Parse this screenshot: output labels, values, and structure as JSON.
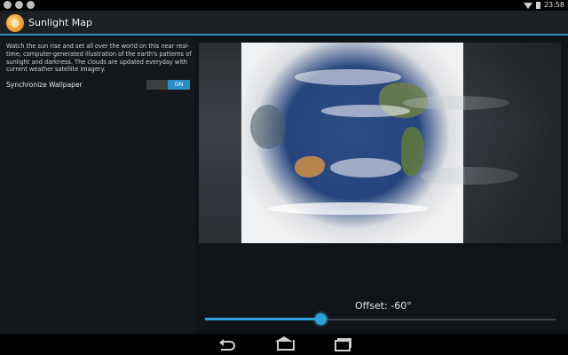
{
  "status_bar": {
    "time": "23:58",
    "left_icons": [
      "notification-icon",
      "sync-icon",
      "android-icon"
    ],
    "right_icons": [
      "wifi-icon",
      "battery-icon"
    ]
  },
  "action_bar": {
    "title": "Sunlight Map",
    "icon": "sun-globe-icon",
    "accent_color": "#2e8ec0"
  },
  "left_panel": {
    "description": "Watch the sun rise and set all over the world on this near real-time, computer-generated illustration of the earth's patterns of sunlight and darkness. The clouds are updated everyday with current weather satellite imagery.",
    "sync": {
      "label": "Synchronize Wallpaper",
      "toggle_state": "ON"
    }
  },
  "offset": {
    "label": "Offset: -60°",
    "value_degrees": -60,
    "slider_fraction": 0.33
  },
  "nav_bar": {
    "buttons": [
      "back-icon",
      "home-icon",
      "recents-icon"
    ]
  }
}
